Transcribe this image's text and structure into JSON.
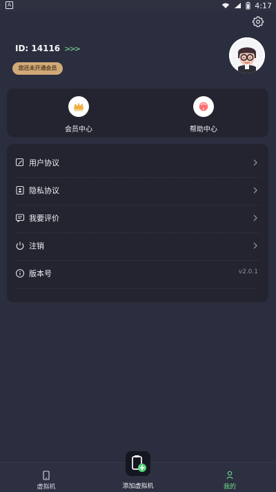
{
  "status_bar": {
    "app_indicator": "A",
    "time": "4:17"
  },
  "profile": {
    "id_text": "ID: 14116",
    "arrows": ">>>",
    "membership_badge": "您还未开通会员"
  },
  "quick_actions": [
    {
      "label": "会员中心",
      "icon": "crown-icon"
    },
    {
      "label": "帮助中心",
      "icon": "help-icon"
    }
  ],
  "menu": {
    "items": [
      {
        "label": "用户协议",
        "icon": "edit-document-icon"
      },
      {
        "label": "隐私协议",
        "icon": "privacy-document-icon"
      },
      {
        "label": "我要评价",
        "icon": "comment-icon"
      },
      {
        "label": "注销",
        "icon": "power-icon"
      },
      {
        "label": "版本号",
        "icon": "info-icon",
        "value": "v2.0.1"
      }
    ]
  },
  "bottom_nav": {
    "items": [
      {
        "label": "虚拟机",
        "icon": "phone-icon",
        "active": false
      },
      {
        "label": "添加虚拟机",
        "icon": "add-vm-icon",
        "active": false
      },
      {
        "label": "我的",
        "icon": "user-icon",
        "active": true
      }
    ]
  },
  "colors": {
    "background": "#2b2e3e",
    "card": "#23242f",
    "accent_green": "#71d98e",
    "badge_gold": "#d1aa78"
  }
}
